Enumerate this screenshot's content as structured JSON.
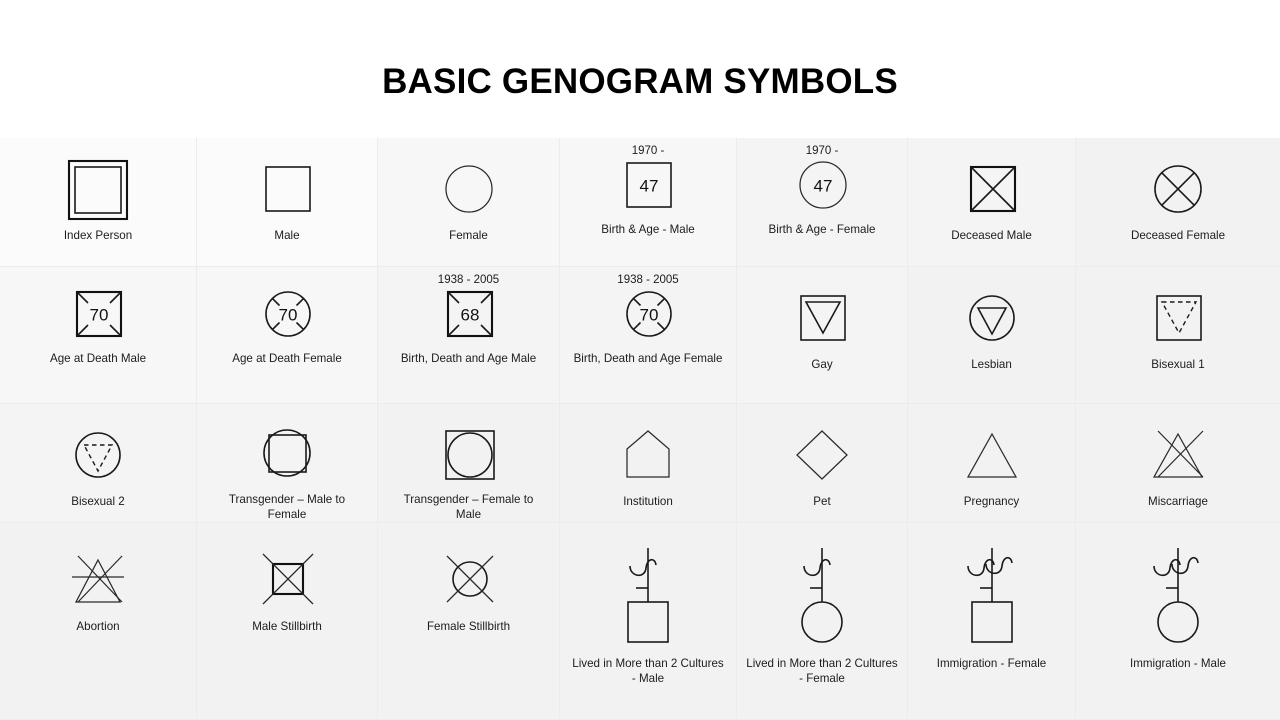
{
  "page": {
    "title": "BASIC GENOGRAM SYMBOLS",
    "background_color": "#ffffff",
    "stroke_color": "#1a1a1a",
    "grid_line_color": "#ececee"
  },
  "grid": {
    "columns": 7,
    "rows": 4,
    "cells": [
      {
        "id": "index-person",
        "top_label": "",
        "caption": "Index Person",
        "symbol": "double-square"
      },
      {
        "id": "male",
        "top_label": "",
        "caption": "Male",
        "symbol": "square"
      },
      {
        "id": "female",
        "top_label": "",
        "caption": "Female",
        "symbol": "circle"
      },
      {
        "id": "birth-age-male",
        "top_label": "1970 -",
        "caption": "Birth & Age - Male",
        "symbol": "square-with-number",
        "number": "47"
      },
      {
        "id": "birth-age-female",
        "top_label": "1970 -",
        "caption": "Birth & Age - Female",
        "symbol": "circle-with-number",
        "number": "47"
      },
      {
        "id": "deceased-male",
        "top_label": "",
        "caption": "Deceased Male",
        "symbol": "square-x"
      },
      {
        "id": "deceased-female",
        "top_label": "",
        "caption": "Deceased  Female",
        "symbol": "circle-x"
      },
      {
        "id": "age-death-male",
        "top_label": "",
        "caption": "Age at Death Male",
        "symbol": "square-corner-x-number",
        "number": "70"
      },
      {
        "id": "age-death-female",
        "top_label": "",
        "caption": "Age at Death Female",
        "symbol": "circle-corner-x-number",
        "number": "70"
      },
      {
        "id": "birth-death-age-male",
        "top_label": "1938 - 2005",
        "caption": "Birth, Death and Age Male",
        "symbol": "square-corner-x-number",
        "number": "68"
      },
      {
        "id": "birth-death-age-female",
        "top_label": "1938 - 2005",
        "caption": "Birth, Death and Age Female",
        "symbol": "circle-corner-x-number",
        "number": "70"
      },
      {
        "id": "gay",
        "top_label": "",
        "caption": "Gay",
        "symbol": "square-triangle"
      },
      {
        "id": "lesbian",
        "top_label": "",
        "caption": "Lesbian",
        "symbol": "circle-triangle"
      },
      {
        "id": "bisexual-1",
        "top_label": "",
        "caption": "Bisexual 1",
        "symbol": "square-dashed-triangle"
      },
      {
        "id": "bisexual-2",
        "top_label": "",
        "caption": "Bisexual 2",
        "symbol": "circle-dashed-triangle"
      },
      {
        "id": "transgender-mtf",
        "top_label": "",
        "caption": "Transgender – Male to Female",
        "symbol": "circle-over-square"
      },
      {
        "id": "transgender-ftm",
        "top_label": "",
        "caption": "Transgender – Female to Male",
        "symbol": "square-over-circle"
      },
      {
        "id": "institution",
        "top_label": "",
        "caption": "Institution",
        "symbol": "house-pentagon"
      },
      {
        "id": "pet",
        "top_label": "",
        "caption": "Pet",
        "symbol": "diamond"
      },
      {
        "id": "pregnancy",
        "top_label": "",
        "caption": "Pregnancy",
        "symbol": "triangle"
      },
      {
        "id": "miscarriage",
        "top_label": "",
        "caption": "Miscarriage",
        "symbol": "triangle-x"
      },
      {
        "id": "abortion",
        "top_label": "",
        "caption": "Abortion",
        "symbol": "triangle-x-bar"
      },
      {
        "id": "male-stillbirth",
        "top_label": "",
        "caption": "Male Stillbirth",
        "symbol": "square-x-extended"
      },
      {
        "id": "female-stillbirth",
        "top_label": "",
        "caption": "Female Stillbirth",
        "symbol": "circle-x-extended"
      },
      {
        "id": "cultures-male",
        "top_label": "",
        "caption": "Lived in More than 2 Cultures - Male",
        "symbol": "squiggle-single-square"
      },
      {
        "id": "cultures-female",
        "top_label": "",
        "caption": "Lived in More than 2 Cultures - Female",
        "symbol": "squiggle-single-circle"
      },
      {
        "id": "immigration-female",
        "top_label": "",
        "caption": "Immigration - Female",
        "symbol": "squiggle-double-square"
      },
      {
        "id": "immigration-male",
        "top_label": "",
        "caption": "Immigration - Male",
        "symbol": "squiggle-double-circle"
      }
    ]
  }
}
